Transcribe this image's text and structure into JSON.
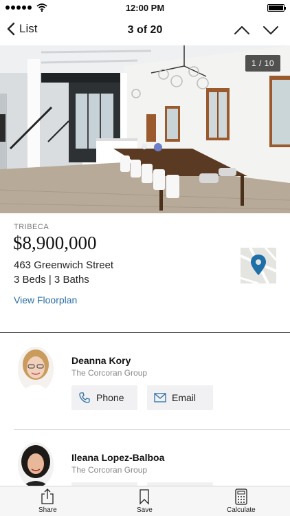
{
  "status": {
    "time": "12:00 PM"
  },
  "nav": {
    "back_label": "List",
    "counter": "3 of 20"
  },
  "photo": {
    "counter": "1 / 10"
  },
  "listing": {
    "neighborhood": "TRIBECA",
    "price": "$8,900,000",
    "address": "463 Greenwich Street",
    "beds_baths": "3 Beds | 3 Baths",
    "floorplan_link": "View Floorplan"
  },
  "agents": [
    {
      "name": "Deanna Kory",
      "company": "The Corcoran Group",
      "phone_label": "Phone",
      "email_label": "Email"
    },
    {
      "name": "Ileana Lopez-Balboa",
      "company": "The Corcoran Group"
    }
  ],
  "tabs": [
    {
      "label": "Share",
      "icon": "share-icon"
    },
    {
      "label": "Save",
      "icon": "bookmark-icon"
    },
    {
      "label": "Calculate",
      "icon": "calculator-icon"
    }
  ],
  "colors": {
    "link": "#2a6ea6",
    "map_pin": "#1f6fa8",
    "button_bg": "#f1f1f3"
  }
}
